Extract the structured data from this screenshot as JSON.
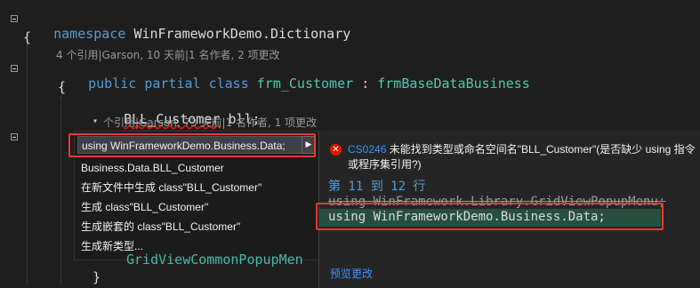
{
  "code": {
    "line1": {
      "keyword": "namespace",
      "name": "WinFrameworkDemo.Dictionary"
    },
    "open_brace": "{",
    "lens_class": "4 个引用|Garson, 10 天前|1 名作者, 2 项更改",
    "line_class": {
      "kw1": "public",
      "kw2": "partial",
      "kw3": "class",
      "name": "frm_Customer",
      "sep": ":",
      "base": "frmBaseDataBusiness"
    },
    "open_brace2": "{",
    "line_field": {
      "type": "BLL_Customer",
      "name": "bll;"
    },
    "lens_field": "个引用|Garson, 73 天前|1 名作者, 1 项更改",
    "hidden_line": "GridViewCommonPopupMen",
    "close_brace": "}"
  },
  "quick_actions": {
    "items": [
      "using WinFrameworkDemo.Business.Data;",
      "Business.Data.BLL_Customer",
      "在新文件中生成 class\"BLL_Customer\"",
      "生成 class\"BLL_Customer\"",
      "生成嵌套的 class\"BLL_Customer\"",
      "生成新类型..."
    ],
    "submenu_arrow": "▶",
    "lightbulb_chevron": "▾"
  },
  "preview": {
    "error_icon": "✕",
    "error_code": "CS0246",
    "error_message": "未能找到类型或命名空间名\"BLL_Customer\"(是否缺少 using 指令或程序集引用?)",
    "lines_label": "第 11 到 12 行",
    "removed_line": "using WinFramework.Library.GridViewPopupMenu;",
    "added_line": "using WinFrameworkDemo.Business.Data;",
    "preview_changes": "预览更改"
  },
  "colors": {
    "background": "#1e1e1e",
    "keyword": "#569cd6",
    "type": "#4ec9b0",
    "highlight_box": "#e53935",
    "added_bg": "#264f3f"
  }
}
